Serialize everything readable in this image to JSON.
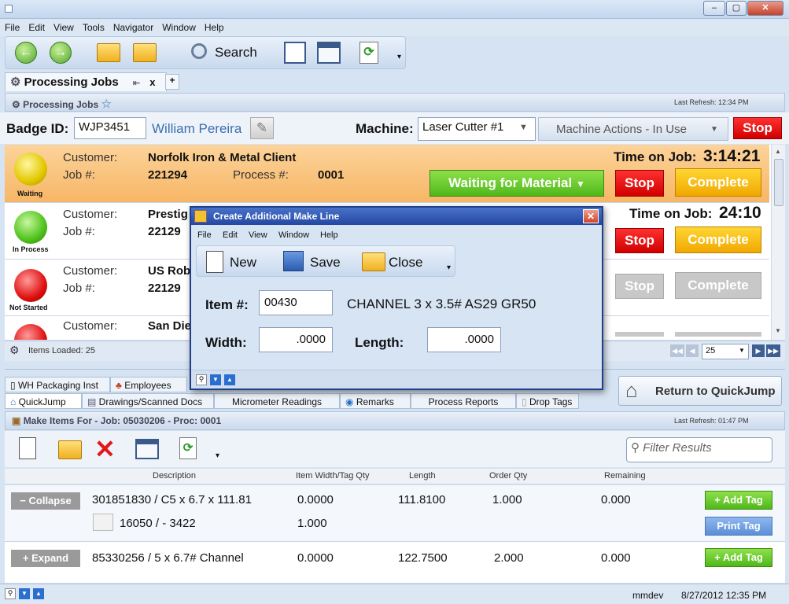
{
  "window": {
    "min": "‒",
    "max": "▢",
    "close": "✕"
  },
  "menu": [
    "File",
    "Edit",
    "View",
    "Tools",
    "Navigator",
    "Window",
    "Help"
  ],
  "toolbar": {
    "search_label": "Search"
  },
  "doc_tab": {
    "title": "Processing Jobs",
    "pin": "⇤",
    "close": "x",
    "add": "+"
  },
  "panel": {
    "title": "Processing Jobs",
    "last_refresh": "Last Refresh: 12:34 PM"
  },
  "badge": {
    "label": "Badge ID:",
    "value": "WJP3451",
    "name": "William Pereira",
    "machine_label": "Machine:",
    "machine_value": "Laser Cutter #1",
    "actions": "Machine Actions - In Use",
    "stop": "Stop"
  },
  "jobs": [
    {
      "status": "Waiting",
      "customer_lbl": "Customer:",
      "customer": "Norfolk Iron & Metal Client",
      "job_lbl": "Job #:",
      "job": "221294",
      "process_lbl": "Process #:",
      "process": "0001",
      "time_lbl": "Time on Job:",
      "time": "3:14:21",
      "action": "Waiting for Material",
      "stop": "Stop",
      "complete": "Complete"
    },
    {
      "status": "In Process",
      "customer_lbl": "Customer:",
      "customer": "Prestig",
      "job_lbl": "Job #:",
      "job": "22129",
      "time_lbl": "Time on Job:",
      "time": "24:10",
      "stop": "Stop",
      "complete": "Complete"
    },
    {
      "status": "Not Started",
      "customer_lbl": "Customer:",
      "customer": "US Rob",
      "job_lbl": "Job #:",
      "job": "22129",
      "stop": "Stop",
      "complete": "Complete"
    },
    {
      "customer_lbl": "Customer:",
      "customer": "San Die"
    }
  ],
  "pager": {
    "items_loaded": "Items Loaded: 25",
    "page_size": "25"
  },
  "lower_tabs_row1": [
    "WH Packaging Inst",
    "Employees"
  ],
  "lower_tabs_row2": [
    "QuickJump",
    "Drawings/Scanned Docs",
    "Micrometer Readings",
    "Remarks",
    "Process Reports",
    "Drop Tags"
  ],
  "return_btn": "Return to QuickJump",
  "make_items": {
    "title": "Make Items For - Job: 05030206 - Proc: 0001",
    "last_refresh": "Last Refresh: 01:47 PM",
    "filter_placeholder": "Filter Results"
  },
  "grid": {
    "headers": [
      "Description",
      "Item Width/Tag Qty",
      "Length",
      "Order Qty",
      "Remaining"
    ],
    "rows": [
      {
        "toggle": "− Collapse",
        "desc": "301851830 / C5 x 6.7 x 111.81",
        "width": "0.0000",
        "length": "111.8100",
        "order": "1.000",
        "remaining": "0.000",
        "add": "+ Add Tag",
        "sub_desc": "16050 / - 3422",
        "sub_qty": "1.000",
        "print": "Print Tag"
      },
      {
        "toggle": "+ Expand",
        "desc": "85330256 / 5 x 6.7# Channel",
        "width": "0.0000",
        "length": "122.7500",
        "order": "2.000",
        "remaining": "0.000",
        "add": "+ Add Tag"
      }
    ]
  },
  "statusbar": {
    "user": "mmdev",
    "datetime": "8/27/2012  12:35 PM"
  },
  "dialog": {
    "title": "Create Additional Make Line",
    "menu": [
      "File",
      "Edit",
      "View",
      "Window",
      "Help"
    ],
    "new": "New",
    "save": "Save",
    "close": "Close",
    "item_lbl": "Item #:",
    "item": "00430",
    "item_desc": "CHANNEL 3 x 3.5#  AS29 GR50",
    "width_lbl": "Width:",
    "width": ".0000",
    "length_lbl": "Length:",
    "length": ".0000"
  }
}
